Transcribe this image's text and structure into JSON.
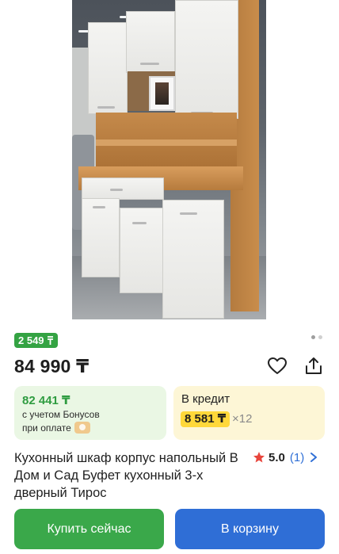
{
  "product_image": {
    "alt": "Кухонный шкаф корпус напольный"
  },
  "gallery": {
    "dots_count": 2,
    "active_index": 0
  },
  "bonus_badge": {
    "text": "2 549 ",
    "currency_icon": "bonus-currency-icon"
  },
  "price": {
    "text": "84 990 ₸"
  },
  "actions": {
    "favorite_icon": "heart-icon",
    "share_icon": "share-icon"
  },
  "bonus_card": {
    "price": "82 441 ₸",
    "line1": "с учетом Бонусов",
    "line2": "при оплате",
    "coin_icon": "bonus-coin-icon"
  },
  "credit_card": {
    "title": "В кредит",
    "monthly": "8 581 ₸",
    "times": "×12"
  },
  "product": {
    "title": "Кухонный шкаф корпус напольный В Дом и Сад Буфет кухонный 3-х дверный Тирос"
  },
  "rating": {
    "value": "5.0",
    "count": "(1)",
    "star_color": "#e8453c"
  },
  "buttons": {
    "buy_now": "Купить сейчас",
    "add_to_cart": "В корзину"
  },
  "colors": {
    "green": "#3aa84a",
    "blue": "#2f6ed6",
    "yellow": "#ffd83a"
  }
}
